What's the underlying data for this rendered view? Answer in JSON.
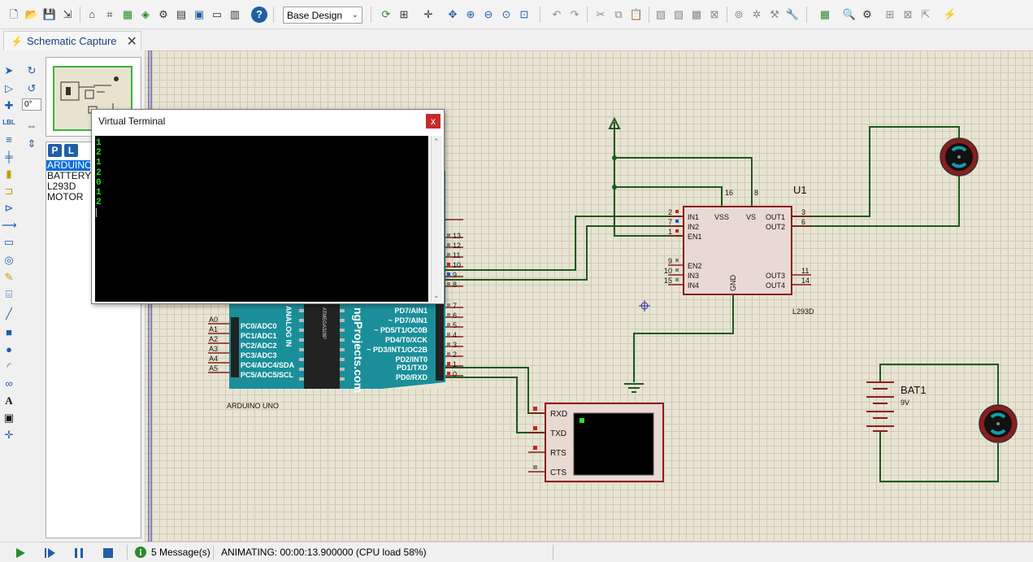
{
  "toolbar": {
    "design_select": "Base Design",
    "help_label": "?"
  },
  "tab": {
    "label": "Schematic Capture",
    "close": "✕"
  },
  "sidebar": {
    "rotation_value": "0°",
    "picker_p": "P",
    "picker_l": "L",
    "devices": [
      "ARDUINO",
      "BATTERY",
      "L293D",
      "MOTOR"
    ]
  },
  "virtual_terminal": {
    "title": "Virtual Terminal",
    "close": "x",
    "lines": [
      "1",
      "2",
      "1",
      "2",
      "0",
      "1",
      "2"
    ]
  },
  "schematic": {
    "u1_ref": "U1",
    "u1_part": "L293D",
    "u1_pins_left": [
      "IN1",
      "IN2",
      "EN1",
      "EN2",
      "IN3",
      "IN4"
    ],
    "u1_pin_nums_left": [
      "2",
      "7",
      "1",
      "9",
      "10",
      "15"
    ],
    "u1_pins_right": [
      "OUT1",
      "OUT2",
      "OUT3",
      "OUT4"
    ],
    "u1_pin_nums_right": [
      "3",
      "6",
      "11",
      "14"
    ],
    "u1_top": [
      "VSS",
      "VS"
    ],
    "u1_top_nums": [
      "16",
      "8"
    ],
    "u1_gnd": "GND",
    "bat_ref": "BAT1",
    "bat_val": "9V",
    "arduino_label": "ARDUINO UNO",
    "arduino_brand": "ngProjects.com",
    "arduino_chip": "ATMEGA328P",
    "arduino_analog": "ANALOG IN",
    "arduino_digital_pins": [
      "13",
      "12",
      "11",
      "10",
      "9",
      "8",
      "7",
      "6",
      "5",
      "4",
      "3",
      "2",
      "1",
      "0"
    ],
    "arduino_right_labels": [
      "PD7/AIN1",
      "~ PD7/AIN1",
      "~ PD5/T1/OC0B",
      "PD4/T0/XCK",
      "~ PD3/INT1/OC2B",
      "PD2/INT0",
      "PD1/TXD",
      "PD0/RXD"
    ],
    "arduino_left_labels": [
      "PC0/ADC0",
      "PC1/ADC1",
      "PC2/ADC2",
      "PC3/ADC3",
      "PC4/ADC4/SDA",
      "PC5/ADC5/SCL"
    ],
    "arduino_analog_pins": [
      "A0",
      "A1",
      "A2",
      "A3",
      "A4",
      "A5"
    ],
    "vt_pins": [
      "RXD",
      "TXD",
      "RTS",
      "CTS"
    ]
  },
  "status": {
    "messages": "5 Message(s)",
    "animating": "ANIMATING: 00:00:13.900000 (CPU load 58%)"
  },
  "colors": {
    "wire": "#1e5a1e",
    "chip_fill": "#e9d9d3",
    "chip_stroke": "#8b1d1d",
    "arduino": "#1a8f9a",
    "terminal_green": "#28e028"
  }
}
